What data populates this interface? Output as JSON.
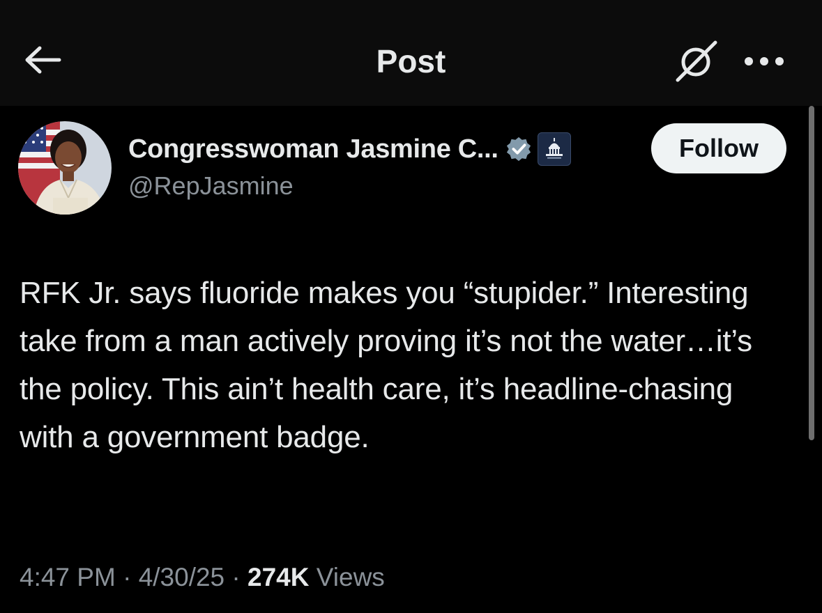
{
  "header": {
    "title": "Post",
    "back_icon": "arrow-left-icon",
    "grok_icon": "grok-icon",
    "more_icon": "more-dots-icon"
  },
  "author": {
    "display_name": "Congresswoman Jasmine C...",
    "handle": "@RepJasmine",
    "verified_color": "#829aab",
    "affiliation_icon": "capitol-building-icon",
    "follow_label": "Follow"
  },
  "post": {
    "text": "RFK Jr. says fluoride makes you “stupider.” Interesting take from a man actively proving it’s not the water…it’s the policy. This ain’t health care, it’s headline-chasing with a government badge."
  },
  "meta": {
    "time": "4:47 PM",
    "separator": " · ",
    "date": "4/30/25",
    "views_count": "274K",
    "views_label": "Views"
  },
  "colors": {
    "background": "#000000",
    "header_bg": "#0c0c0c",
    "primary_text": "#e7e9ea",
    "secondary_text": "#8b9299",
    "follow_bg": "#eff3f4"
  }
}
